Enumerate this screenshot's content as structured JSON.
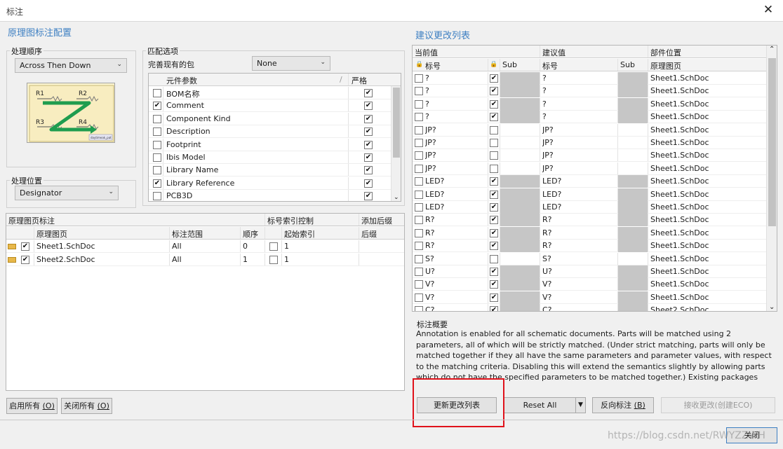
{
  "window": {
    "title": "标注",
    "close_glyph": "✕"
  },
  "left_title": "原理图标注配置",
  "right_title": "建议更改列表",
  "process_order": {
    "label": "处理顺序",
    "value": "Across Then Down"
  },
  "diagram": {
    "labels": [
      "R1",
      "R2",
      "R3",
      "R4"
    ],
    "caption": "daytimeak_pat"
  },
  "process_location": {
    "label": "处理位置",
    "value": "Designator"
  },
  "match_options": {
    "label": "匹配选项",
    "complete_label": "完善现有的包",
    "complete_value": "None",
    "col_param": "元件参数",
    "col_strict": "严格",
    "items": [
      {
        "label": "BOM名称",
        "checked": false,
        "strict": true
      },
      {
        "label": "Comment",
        "checked": true,
        "strict": true
      },
      {
        "label": "Component Kind",
        "checked": false,
        "strict": true
      },
      {
        "label": "Description",
        "checked": false,
        "strict": true
      },
      {
        "label": "Footprint",
        "checked": false,
        "strict": true
      },
      {
        "label": "Ibis Model",
        "checked": false,
        "strict": true
      },
      {
        "label": "Library Name",
        "checked": false,
        "strict": true
      },
      {
        "label": "Library Reference",
        "checked": true,
        "strict": true
      },
      {
        "label": "PCB3D",
        "checked": false,
        "strict": true
      }
    ]
  },
  "sheets": {
    "group1": "原理图页标注",
    "group2": "标号索引控制",
    "group3": "添加后缀",
    "col_sheet": "原理图页",
    "col_scope": "标注范围",
    "col_order": "顺序",
    "col_start": "起始索引",
    "col_suffix": "后缀",
    "rows": [
      {
        "name": "Sheet1.SchDoc",
        "scope": "All",
        "order": "0",
        "start": "1",
        "checked": true
      },
      {
        "name": "Sheet2.SchDoc",
        "scope": "All",
        "order": "1",
        "start": "1",
        "checked": true
      }
    ]
  },
  "changes": {
    "group_current": "当前值",
    "group_proposed": "建议值",
    "group_location": "部件位置",
    "col_designator": "标号",
    "col_sub": "Sub",
    "col_sheet": "原理图页",
    "rows": [
      {
        "cur": "?",
        "lock": true,
        "sub_grey": true,
        "prop": "?",
        "prop_sub_grey": true,
        "sheet": "Sheet1.SchDoc"
      },
      {
        "cur": "?",
        "lock": true,
        "sub_grey": true,
        "prop": "?",
        "prop_sub_grey": true,
        "sheet": "Sheet1.SchDoc"
      },
      {
        "cur": "?",
        "lock": true,
        "sub_grey": true,
        "prop": "?",
        "prop_sub_grey": true,
        "sheet": "Sheet1.SchDoc"
      },
      {
        "cur": "?",
        "lock": true,
        "sub_grey": true,
        "prop": "?",
        "prop_sub_grey": true,
        "sheet": "Sheet1.SchDoc"
      },
      {
        "cur": "JP?",
        "lock": false,
        "sub_grey": false,
        "prop": "JP?",
        "prop_sub_grey": false,
        "sheet": "Sheet1.SchDoc"
      },
      {
        "cur": "JP?",
        "lock": false,
        "sub_grey": false,
        "prop": "JP?",
        "prop_sub_grey": false,
        "sheet": "Sheet1.SchDoc"
      },
      {
        "cur": "JP?",
        "lock": false,
        "sub_grey": false,
        "prop": "JP?",
        "prop_sub_grey": false,
        "sheet": "Sheet1.SchDoc"
      },
      {
        "cur": "JP?",
        "lock": false,
        "sub_grey": false,
        "prop": "JP?",
        "prop_sub_grey": false,
        "sheet": "Sheet1.SchDoc"
      },
      {
        "cur": "LED?",
        "lock": true,
        "sub_grey": true,
        "prop": "LED?",
        "prop_sub_grey": true,
        "sheet": "Sheet1.SchDoc"
      },
      {
        "cur": "LED?",
        "lock": true,
        "sub_grey": true,
        "prop": "LED?",
        "prop_sub_grey": true,
        "sheet": "Sheet1.SchDoc"
      },
      {
        "cur": "LED?",
        "lock": true,
        "sub_grey": true,
        "prop": "LED?",
        "prop_sub_grey": true,
        "sheet": "Sheet1.SchDoc"
      },
      {
        "cur": "R?",
        "lock": true,
        "sub_grey": true,
        "prop": "R?",
        "prop_sub_grey": true,
        "sheet": "Sheet1.SchDoc"
      },
      {
        "cur": "R?",
        "lock": true,
        "sub_grey": true,
        "prop": "R?",
        "prop_sub_grey": true,
        "sheet": "Sheet1.SchDoc"
      },
      {
        "cur": "R?",
        "lock": true,
        "sub_grey": true,
        "prop": "R?",
        "prop_sub_grey": true,
        "sheet": "Sheet1.SchDoc"
      },
      {
        "cur": "S?",
        "lock": false,
        "sub_grey": false,
        "prop": "S?",
        "prop_sub_grey": false,
        "sheet": "Sheet1.SchDoc"
      },
      {
        "cur": "U?",
        "lock": true,
        "sub_grey": true,
        "prop": "U?",
        "prop_sub_grey": true,
        "sheet": "Sheet1.SchDoc"
      },
      {
        "cur": "V?",
        "lock": true,
        "sub_grey": true,
        "prop": "V?",
        "prop_sub_grey": true,
        "sheet": "Sheet1.SchDoc"
      },
      {
        "cur": "V?",
        "lock": true,
        "sub_grey": true,
        "prop": "V?",
        "prop_sub_grey": true,
        "sheet": "Sheet1.SchDoc"
      },
      {
        "cur": "C?",
        "lock": true,
        "sub_grey": true,
        "prop": "C?",
        "prop_sub_grey": true,
        "sheet": "Sheet2.SchDoc"
      }
    ]
  },
  "summary": {
    "label": "标注概要",
    "text": "Annotation is enabled for all schematic documents. Parts will be matched using 2 parameters, all of which will be strictly matched. (Under strict matching, parts will only be matched together if they all have the same parameters and parameter values, with respect to the matching criteria. Disabling this will extend the semantics slightly by allowing parts which do not have the specified parameters to be matched together.) Existing packages will not be completed. All new parts will be put into new"
  },
  "buttons": {
    "enable_all": "启用所有",
    "enable_all_key": "(O)",
    "disable_all": "关闭所有",
    "disable_all_key": "(O)",
    "update_list": "更新更改列表",
    "reset_all": "Reset All",
    "back_annotate": "反向标注",
    "back_annotate_key": "(B)",
    "accept_eco": "接收更改(创建ECO)",
    "close": "关闭"
  },
  "watermark": "https://blog.csdn.net/RWYZZWH",
  "colors": {
    "accent": "#3d7fc2",
    "highlight": "#e0121b",
    "grey_cell": "#c6c6c6"
  }
}
